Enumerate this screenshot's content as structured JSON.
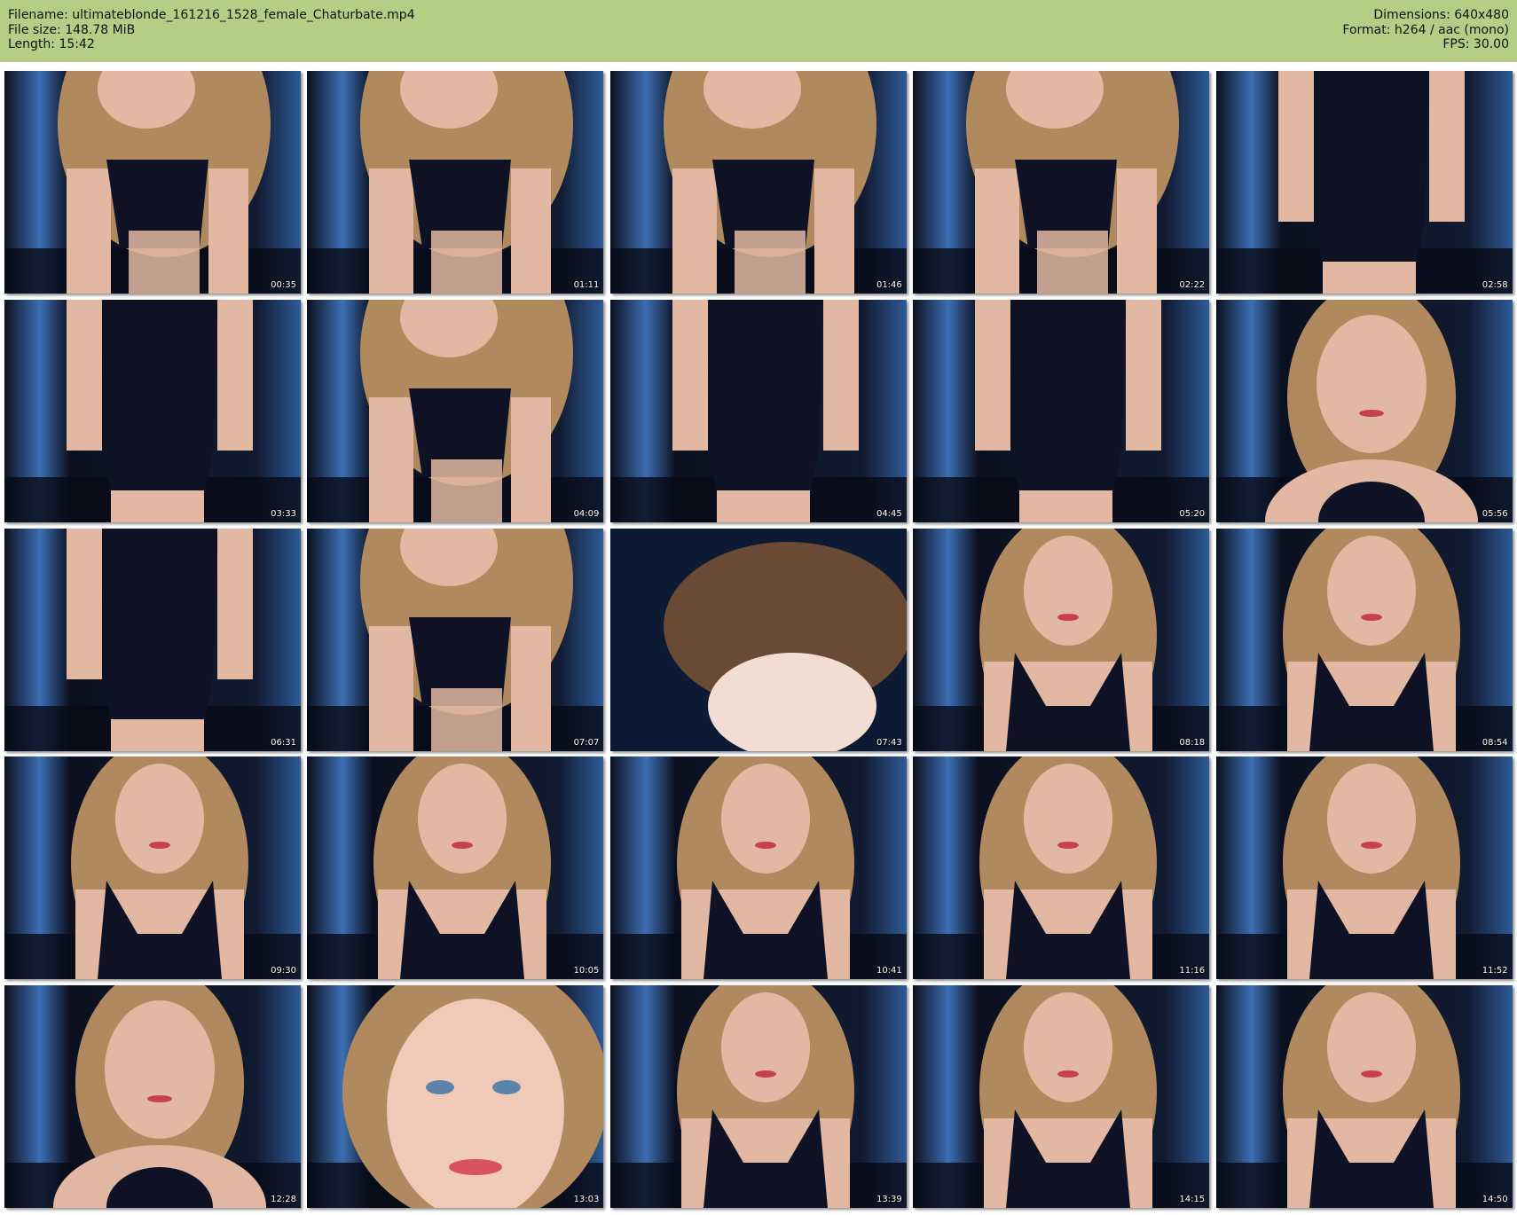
{
  "header": {
    "left_lines": [
      "Filename: ultimateblonde_161216_1528_female_Chaturbate.mp4",
      "File size: 148.78 MiB",
      "Length: 15:42"
    ],
    "right_lines": [
      "Dimensions: 640x480",
      "Format: h264 / aac (mono)",
      "FPS: 30.00"
    ]
  },
  "colors": {
    "header_bg": "#b3cf85",
    "room_dark": "#0b1020",
    "wall_blue": "#3d6fb3",
    "hair": "#b08a5e",
    "skin": "#e3b8a2",
    "garment": "#0e1224"
  },
  "thumbnails": [
    {
      "time": "00:35",
      "shot": "leaning"
    },
    {
      "time": "01:11",
      "shot": "leaning"
    },
    {
      "time": "01:46",
      "shot": "leaning"
    },
    {
      "time": "02:22",
      "shot": "leaning"
    },
    {
      "time": "02:58",
      "shot": "torso"
    },
    {
      "time": "03:33",
      "shot": "torso"
    },
    {
      "time": "04:09",
      "shot": "leaning"
    },
    {
      "time": "04:45",
      "shot": "torso"
    },
    {
      "time": "05:20",
      "shot": "torso"
    },
    {
      "time": "05:56",
      "shot": "face"
    },
    {
      "time": "06:31",
      "shot": "torso"
    },
    {
      "time": "07:07",
      "shot": "leaning"
    },
    {
      "time": "07:43",
      "shot": "blur"
    },
    {
      "time": "08:18",
      "shot": "seated"
    },
    {
      "time": "08:54",
      "shot": "seated"
    },
    {
      "time": "09:30",
      "shot": "seated"
    },
    {
      "time": "10:05",
      "shot": "seated"
    },
    {
      "time": "10:41",
      "shot": "seated"
    },
    {
      "time": "11:16",
      "shot": "seated"
    },
    {
      "time": "11:52",
      "shot": "seated"
    },
    {
      "time": "12:28",
      "shot": "face"
    },
    {
      "time": "13:03",
      "shot": "closeup"
    },
    {
      "time": "13:39",
      "shot": "seated"
    },
    {
      "time": "14:15",
      "shot": "seated"
    },
    {
      "time": "14:50",
      "shot": "seated"
    }
  ]
}
